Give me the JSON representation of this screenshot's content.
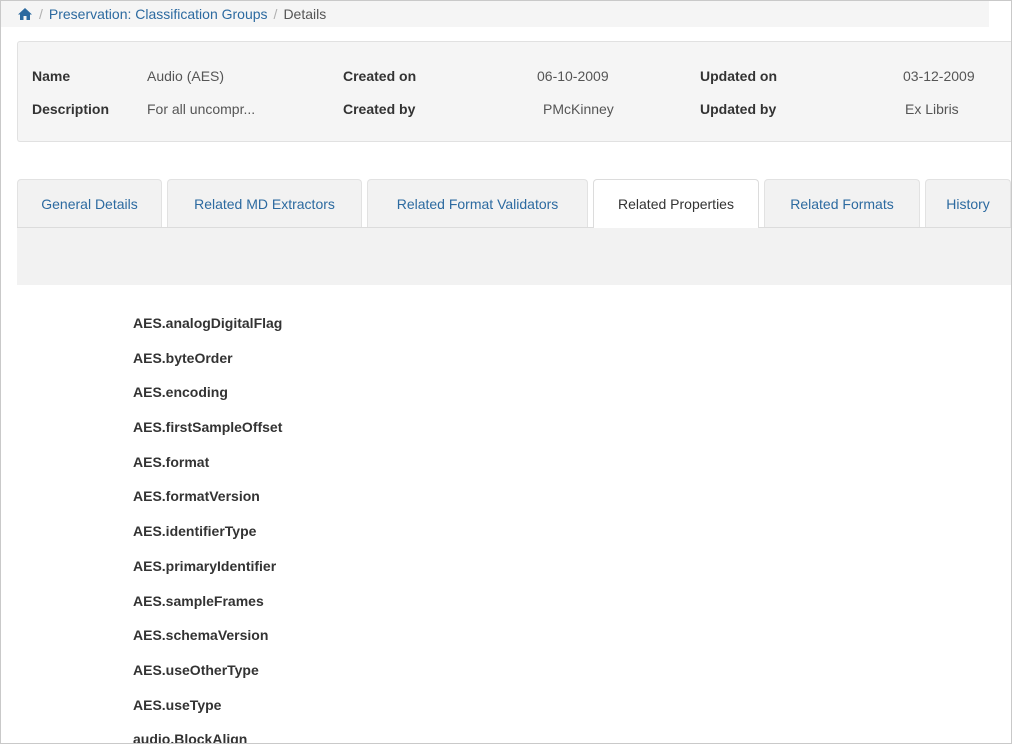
{
  "breadcrumb": {
    "home_icon": "home-icon",
    "items": [
      "Preservation: Classification Groups",
      "Details"
    ],
    "separator": "/"
  },
  "summary": {
    "name_label": "Name",
    "name_value": "Audio (AES)",
    "description_label": "Description",
    "description_value": "For all uncompr...",
    "created_on_label": "Created on",
    "created_on_value": "06-10-2009",
    "created_by_label": "Created by",
    "created_by_value": "PMcKinney",
    "updated_on_label": "Updated on",
    "updated_on_value": "03-12-2009",
    "updated_by_label": "Updated by",
    "updated_by_value": "Ex Libris"
  },
  "tabs": [
    {
      "label": "General Details",
      "active": false
    },
    {
      "label": "Related MD Extractors",
      "active": false
    },
    {
      "label": "Related Format Validators",
      "active": false
    },
    {
      "label": "Related Properties",
      "active": true
    },
    {
      "label": "Related Formats",
      "active": false
    },
    {
      "label": "History",
      "active": false
    }
  ],
  "properties": [
    "AES.analogDigitalFlag",
    "AES.byteOrder",
    "AES.encoding",
    "AES.firstSampleOffset",
    "AES.format",
    "AES.formatVersion",
    "AES.identifierType",
    "AES.primaryIdentifier",
    "AES.sampleFrames",
    "AES.schemaVersion",
    "AES.useOtherType",
    "AES.useType",
    "audio.BlockAlign"
  ],
  "colors": {
    "link": "#2c6aa0",
    "panel_bg": "#f5f5f5",
    "tab_bg": "#f2f2f2"
  }
}
